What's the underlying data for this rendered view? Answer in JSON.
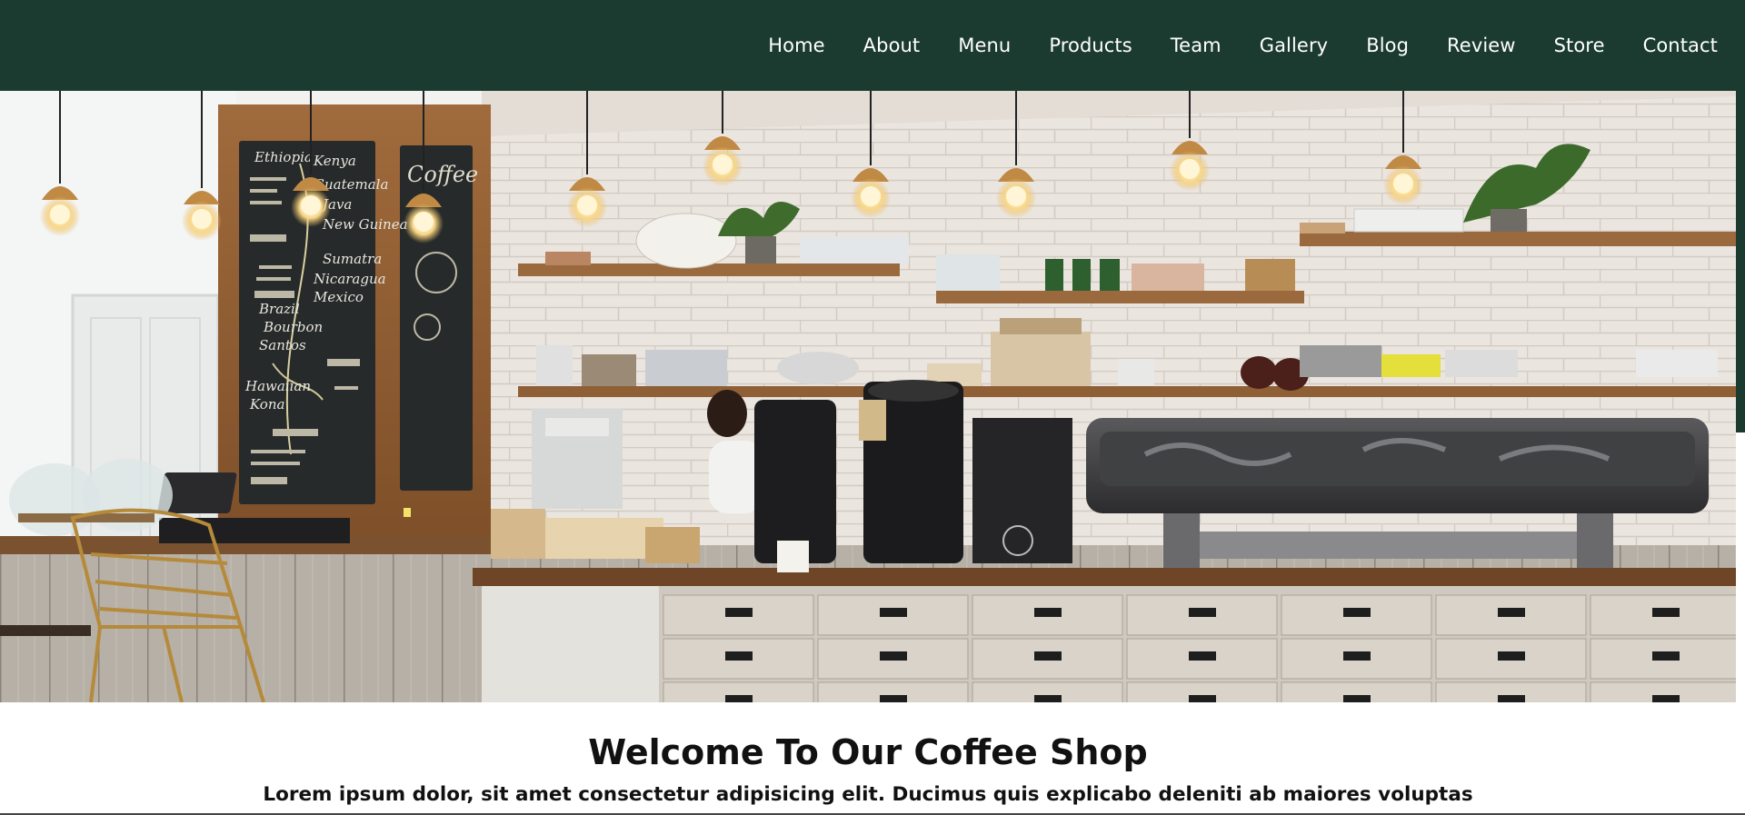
{
  "nav": {
    "items": [
      {
        "label": "Home"
      },
      {
        "label": "About"
      },
      {
        "label": "Menu"
      },
      {
        "label": "Products"
      },
      {
        "label": "Team"
      },
      {
        "label": "Gallery"
      },
      {
        "label": "Blog"
      },
      {
        "label": "Review"
      },
      {
        "label": "Store"
      },
      {
        "label": "Contact"
      }
    ]
  },
  "hero": {
    "image": "coffee-shop-interior-photo",
    "chalkboard_left": [
      "Ethiopia",
      "Kenya",
      "Guatemala",
      "Java",
      "New Guinea",
      "Sumatra",
      "Nicaragua",
      "Mexico",
      "Brazil",
      "Bourbon",
      "Santos",
      "Hawaiian",
      "Kona"
    ],
    "chalkboard_right": "Coffee"
  },
  "welcome": {
    "title": "Welcome To Our Coffee Shop",
    "text": "Lorem ipsum dolor, sit amet consectetur adipisicing elit. Ducimus quis explicabo deleniti ab maiores voluptas"
  },
  "colors": {
    "nav_bg": "#1b3b31",
    "nav_text": "#ffffff",
    "heading_text": "#111111"
  }
}
